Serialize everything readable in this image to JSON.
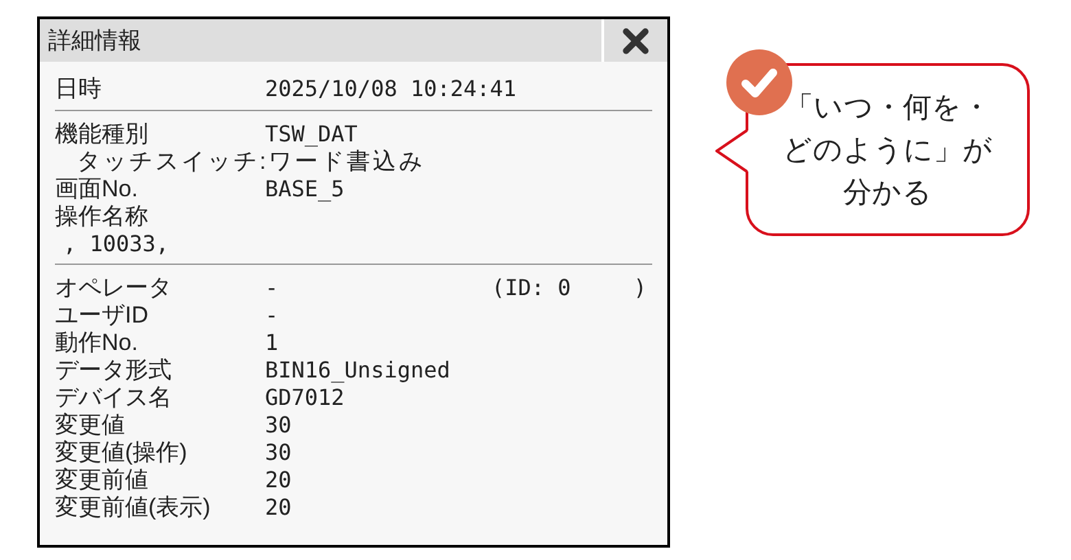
{
  "dialog": {
    "title": "詳細情報",
    "sections": [
      {
        "rows": [
          {
            "kind": "pair",
            "label": "日時",
            "value": "2025/10/08 10:24:41"
          }
        ]
      },
      {
        "rows": [
          {
            "kind": "pair",
            "label": "機能種別",
            "value": "TSW_DAT"
          },
          {
            "kind": "subline",
            "text": "タッチスイッチ:ワード書込み"
          },
          {
            "kind": "pair",
            "label": "画面No.",
            "value": "BASE_5"
          },
          {
            "kind": "pair",
            "label": "操作名称"
          },
          {
            "kind": "line",
            "text": ", 10033,"
          }
        ]
      },
      {
        "rows": [
          {
            "kind": "pair",
            "label": "オペレータ",
            "value": "-",
            "note": "(ID: 0",
            "note_end": ")"
          },
          {
            "kind": "pair",
            "label": "ユーザID",
            "value": "-"
          },
          {
            "kind": "pair",
            "label": "動作No.",
            "value": "1"
          },
          {
            "kind": "pair",
            "label": "データ形式",
            "value": "BIN16_Unsigned"
          },
          {
            "kind": "pair",
            "label": "デバイス名",
            "value": "GD7012"
          },
          {
            "kind": "pair",
            "label": "変更値",
            "value": "30"
          },
          {
            "kind": "pair",
            "label": "変更値(操作)",
            "value": "30"
          },
          {
            "kind": "pair",
            "label": "変更前値",
            "value": "20"
          },
          {
            "kind": "pair",
            "label": "変更前値(表示)",
            "value": "20"
          }
        ]
      }
    ]
  },
  "callout": {
    "lines": [
      "「いつ・何を・",
      "どのように」が",
      "分かる"
    ]
  }
}
